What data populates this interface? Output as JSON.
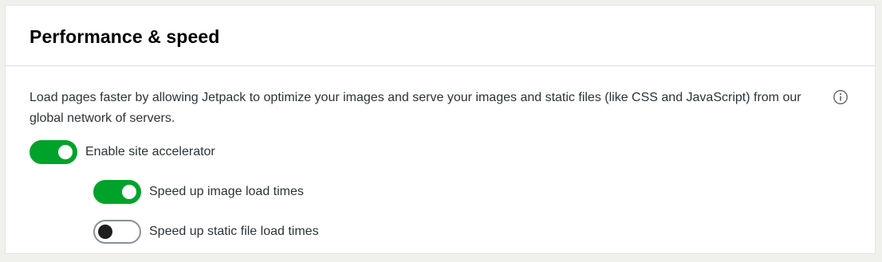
{
  "card": {
    "title": "Performance & speed",
    "description": "Load pages faster by allowing Jetpack to optimize your images and serve your images and static files (like CSS and JavaScript) from our global network of servers.",
    "info_icon": "info-icon"
  },
  "settings": {
    "site_accelerator": {
      "label": "Enable site accelerator",
      "enabled": true
    },
    "image_cdn": {
      "label": "Speed up image load times",
      "enabled": true
    },
    "static_cdn": {
      "label": "Speed up static file load times",
      "enabled": false
    }
  },
  "colors": {
    "toggle_on": "#00a32a",
    "toggle_off_border": "#8c8f94",
    "knob_off": "#1e1e1e"
  }
}
